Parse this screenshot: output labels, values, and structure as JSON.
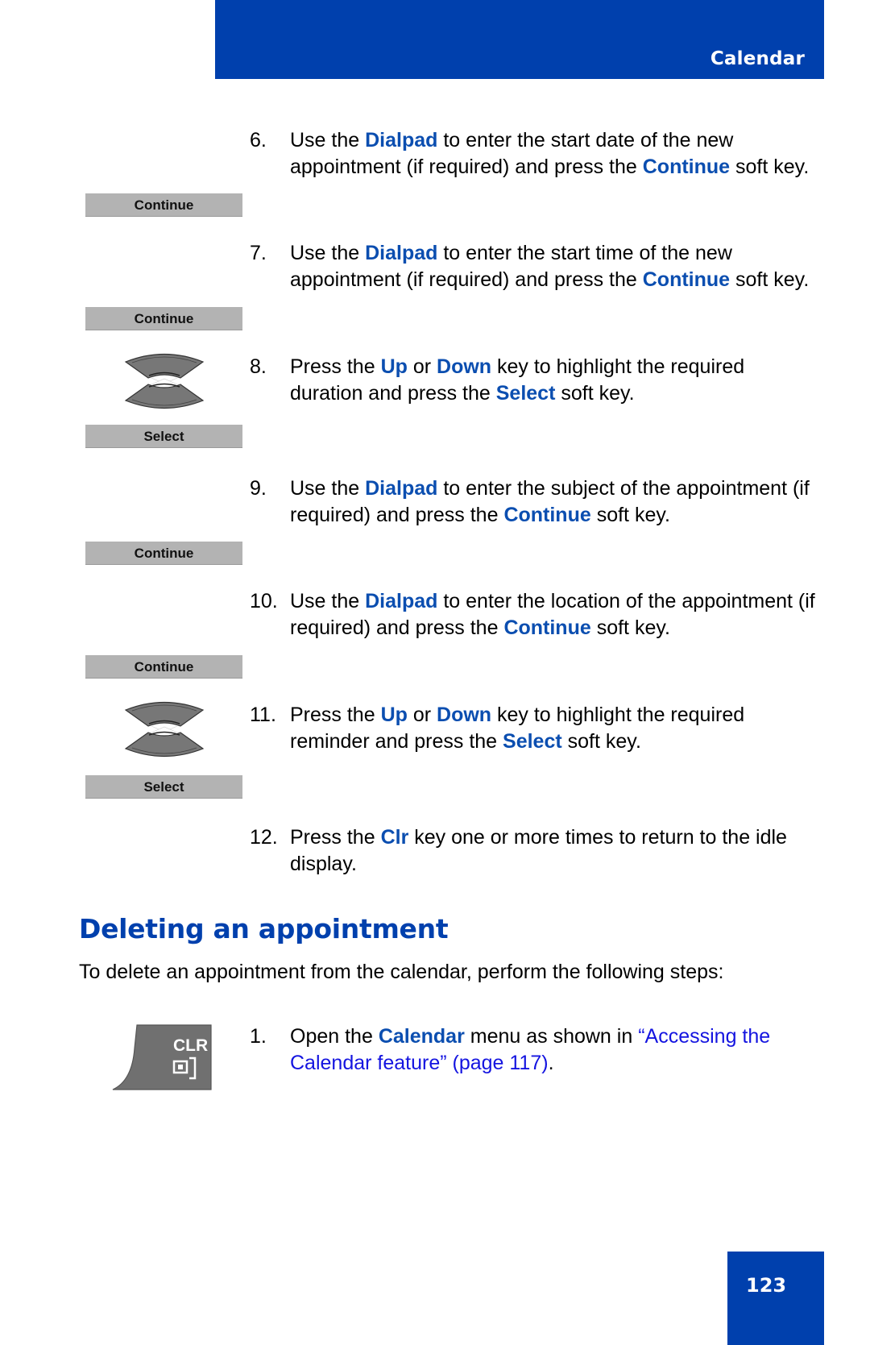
{
  "header": {
    "section_title": "Calendar"
  },
  "soft_keys": {
    "continue_1": "Continue",
    "continue_2": "Continue",
    "select_1": "Select",
    "continue_3": "Continue",
    "continue_4": "Continue",
    "select_2": "Select"
  },
  "icons": {
    "nav_key_1": "up-down-navigation-key-icon",
    "nav_key_2": "up-down-navigation-key-icon",
    "clr_key": "clr-key-icon",
    "clr_key_label": "CLR"
  },
  "steps": [
    {
      "num": "6.",
      "parts": [
        "Use the ",
        "Dialpad",
        " to enter the start date of the new appointment (if required) and press the ",
        "Continue",
        " soft key."
      ]
    },
    {
      "num": "7.",
      "parts": [
        "Use the ",
        "Dialpad",
        " to enter the start time of the new appointment (if required) and press the ",
        "Continue",
        " soft key."
      ]
    },
    {
      "num": "8.",
      "parts": [
        "Press the ",
        "Up",
        " or ",
        "Down",
        " key to highlight the required duration and press the ",
        "Select",
        " soft key."
      ]
    },
    {
      "num": "9.",
      "parts": [
        "Use the ",
        "Dialpad",
        " to enter the subject of the appointment (if required) and press the ",
        "Continue",
        " soft key."
      ]
    },
    {
      "num": "10.",
      "parts": [
        "Use the ",
        "Dialpad",
        " to enter the location of the appointment (if required) and press the ",
        "Continue",
        " soft key."
      ]
    },
    {
      "num": "11.",
      "parts": [
        "Press the ",
        "Up",
        " or ",
        "Down",
        " key to highlight the required reminder and press the ",
        "Select",
        " soft key."
      ]
    },
    {
      "num": "12.",
      "parts": [
        "Press the ",
        "Clr",
        " key one or more times to return to the idle display."
      ]
    }
  ],
  "deleting": {
    "heading": "Deleting an appointment",
    "intro": "To delete an appointment from the calendar, perform the following steps:",
    "step1": {
      "num": "1.",
      "prefix": "Open the ",
      "keyword": "Calendar",
      "middle": " menu as shown in ",
      "link": "“Accessing the Calendar feature” (page 117)",
      "suffix": "."
    }
  },
  "footer": {
    "page_number": "123"
  },
  "colors": {
    "brand_blue": "#0040ad",
    "keyword_blue": "#0b4eb0",
    "link_blue": "#1414e0",
    "softkey_gray": "#b3b3b3"
  }
}
